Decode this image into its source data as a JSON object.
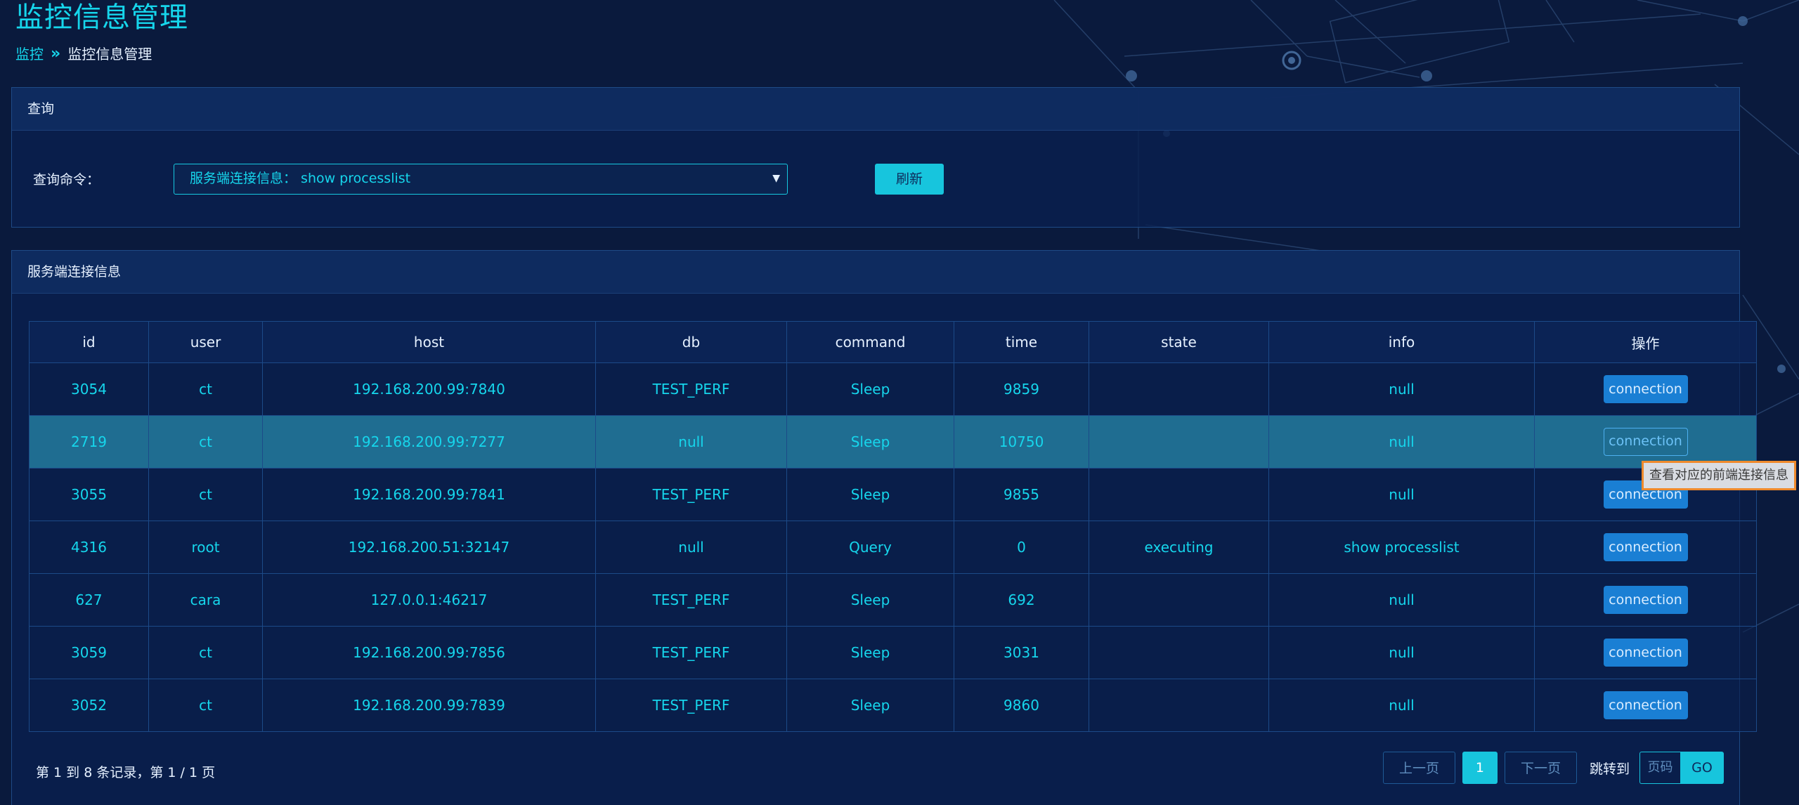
{
  "page": {
    "title": "监控信息管理",
    "breadcrumb": {
      "root": "监控",
      "separator": "»",
      "current": "监控信息管理"
    }
  },
  "query_panel": {
    "title": "查询",
    "label": "查询命令：",
    "select_value": "服务端连接信息： show processlist",
    "refresh_label": "刷新"
  },
  "connection_panel": {
    "title": "服务端连接信息",
    "columns": [
      "id",
      "user",
      "host",
      "db",
      "command",
      "time",
      "state",
      "info",
      "操作"
    ],
    "rows": [
      {
        "id": "3054",
        "user": "ct",
        "host": "192.168.200.99:7840",
        "db": "TEST_PERF",
        "command": "Sleep",
        "time": "9859",
        "state": "",
        "info": "null",
        "action": "connection"
      },
      {
        "id": "2719",
        "user": "ct",
        "host": "192.168.200.99:7277",
        "db": "null",
        "command": "Sleep",
        "time": "10750",
        "state": "",
        "info": "null",
        "action": "connection"
      },
      {
        "id": "3055",
        "user": "ct",
        "host": "192.168.200.99:7841",
        "db": "TEST_PERF",
        "command": "Sleep",
        "time": "9855",
        "state": "",
        "info": "null",
        "action": "connection"
      },
      {
        "id": "4316",
        "user": "root",
        "host": "192.168.200.51:32147",
        "db": "null",
        "command": "Query",
        "time": "0",
        "state": "executing",
        "info": "show processlist",
        "action": "connection"
      },
      {
        "id": "627",
        "user": "cara",
        "host": "127.0.0.1:46217",
        "db": "TEST_PERF",
        "command": "Sleep",
        "time": "692",
        "state": "",
        "info": "null",
        "action": "connection"
      },
      {
        "id": "3059",
        "user": "ct",
        "host": "192.168.200.99:7856",
        "db": "TEST_PERF",
        "command": "Sleep",
        "time": "3031",
        "state": "",
        "info": "null",
        "action": "connection"
      },
      {
        "id": "3052",
        "user": "ct",
        "host": "192.168.200.99:7839",
        "db": "TEST_PERF",
        "command": "Sleep",
        "time": "9860",
        "state": "",
        "info": "null",
        "action": "connection"
      }
    ],
    "hovered_row": 1,
    "tooltip": "查看对应的前端连接信息",
    "pagination": {
      "summary": "第 1 到 8 条记录，第 1 / 1 页",
      "prev_label": "上一页",
      "current_page": "1",
      "next_label": "下一页",
      "jump_label": "跳转到",
      "page_input_placeholder": "页码",
      "go_label": "GO"
    }
  },
  "colors": {
    "accent": "#16d6ec",
    "background": "#0a1a3d",
    "action_button": "#1a7fd4",
    "tooltip_border": "#ef8a2c"
  }
}
